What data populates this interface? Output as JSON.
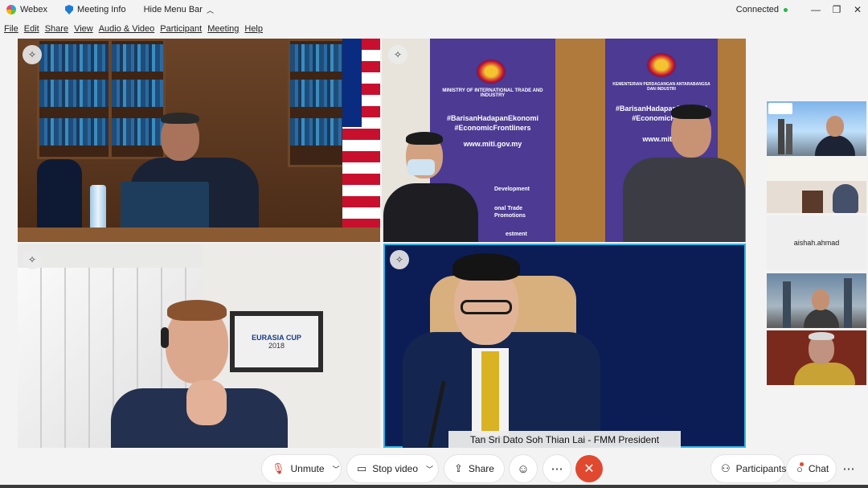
{
  "titlebar": {
    "app_name": "Webex",
    "meeting_info": "Meeting Info",
    "hide_menu": "Hide Menu Bar",
    "status": "Connected",
    "minimize": "—",
    "restore": "❐",
    "close": "✕"
  },
  "menubar": [
    "File",
    "Edit",
    "Share",
    "View",
    "Audio & Video",
    "Participant",
    "Meeting",
    "Help"
  ],
  "tiles": {
    "t4_name": "Tan Sri Dato Soh Thian Lai - FMM President",
    "t3_frame_brand": "EURASIA CUP",
    "t3_frame_year": "2018"
  },
  "banners": {
    "left_ministry": "MINISTRY OF INTERNATIONAL TRADE AND INDUSTRY",
    "left_tag1": "#BarisanHadapanEkonomi",
    "left_tag2": "#EconomicFrontliners",
    "left_url": "www.miti.gov.my",
    "left_small1": "Development",
    "left_small2": "onal Trade",
    "left_small3": "Promotions",
    "left_small4": "estment",
    "right_ministry": "KEMENTERIAN PERDAGANGAN ANTARABANGSA DAN INDUSTRI",
    "right_tag1": "#BarisanHadapanEkonomi",
    "right_tag2": "#EconomicFrontl",
    "right_url": "www.miti.g"
  },
  "strip": {
    "name_only_participant": "aishah.ahmad"
  },
  "controls": {
    "unmute": "Unmute",
    "stop_video": "Stop video",
    "share": "Share",
    "participants": "Participants",
    "chat": "Chat"
  },
  "colors": {
    "active_speaker_border": "#2cb7e8",
    "end_call": "#e0492f",
    "connected_dot": "#2bb24c",
    "ministry_purple": "#4c3a93"
  }
}
